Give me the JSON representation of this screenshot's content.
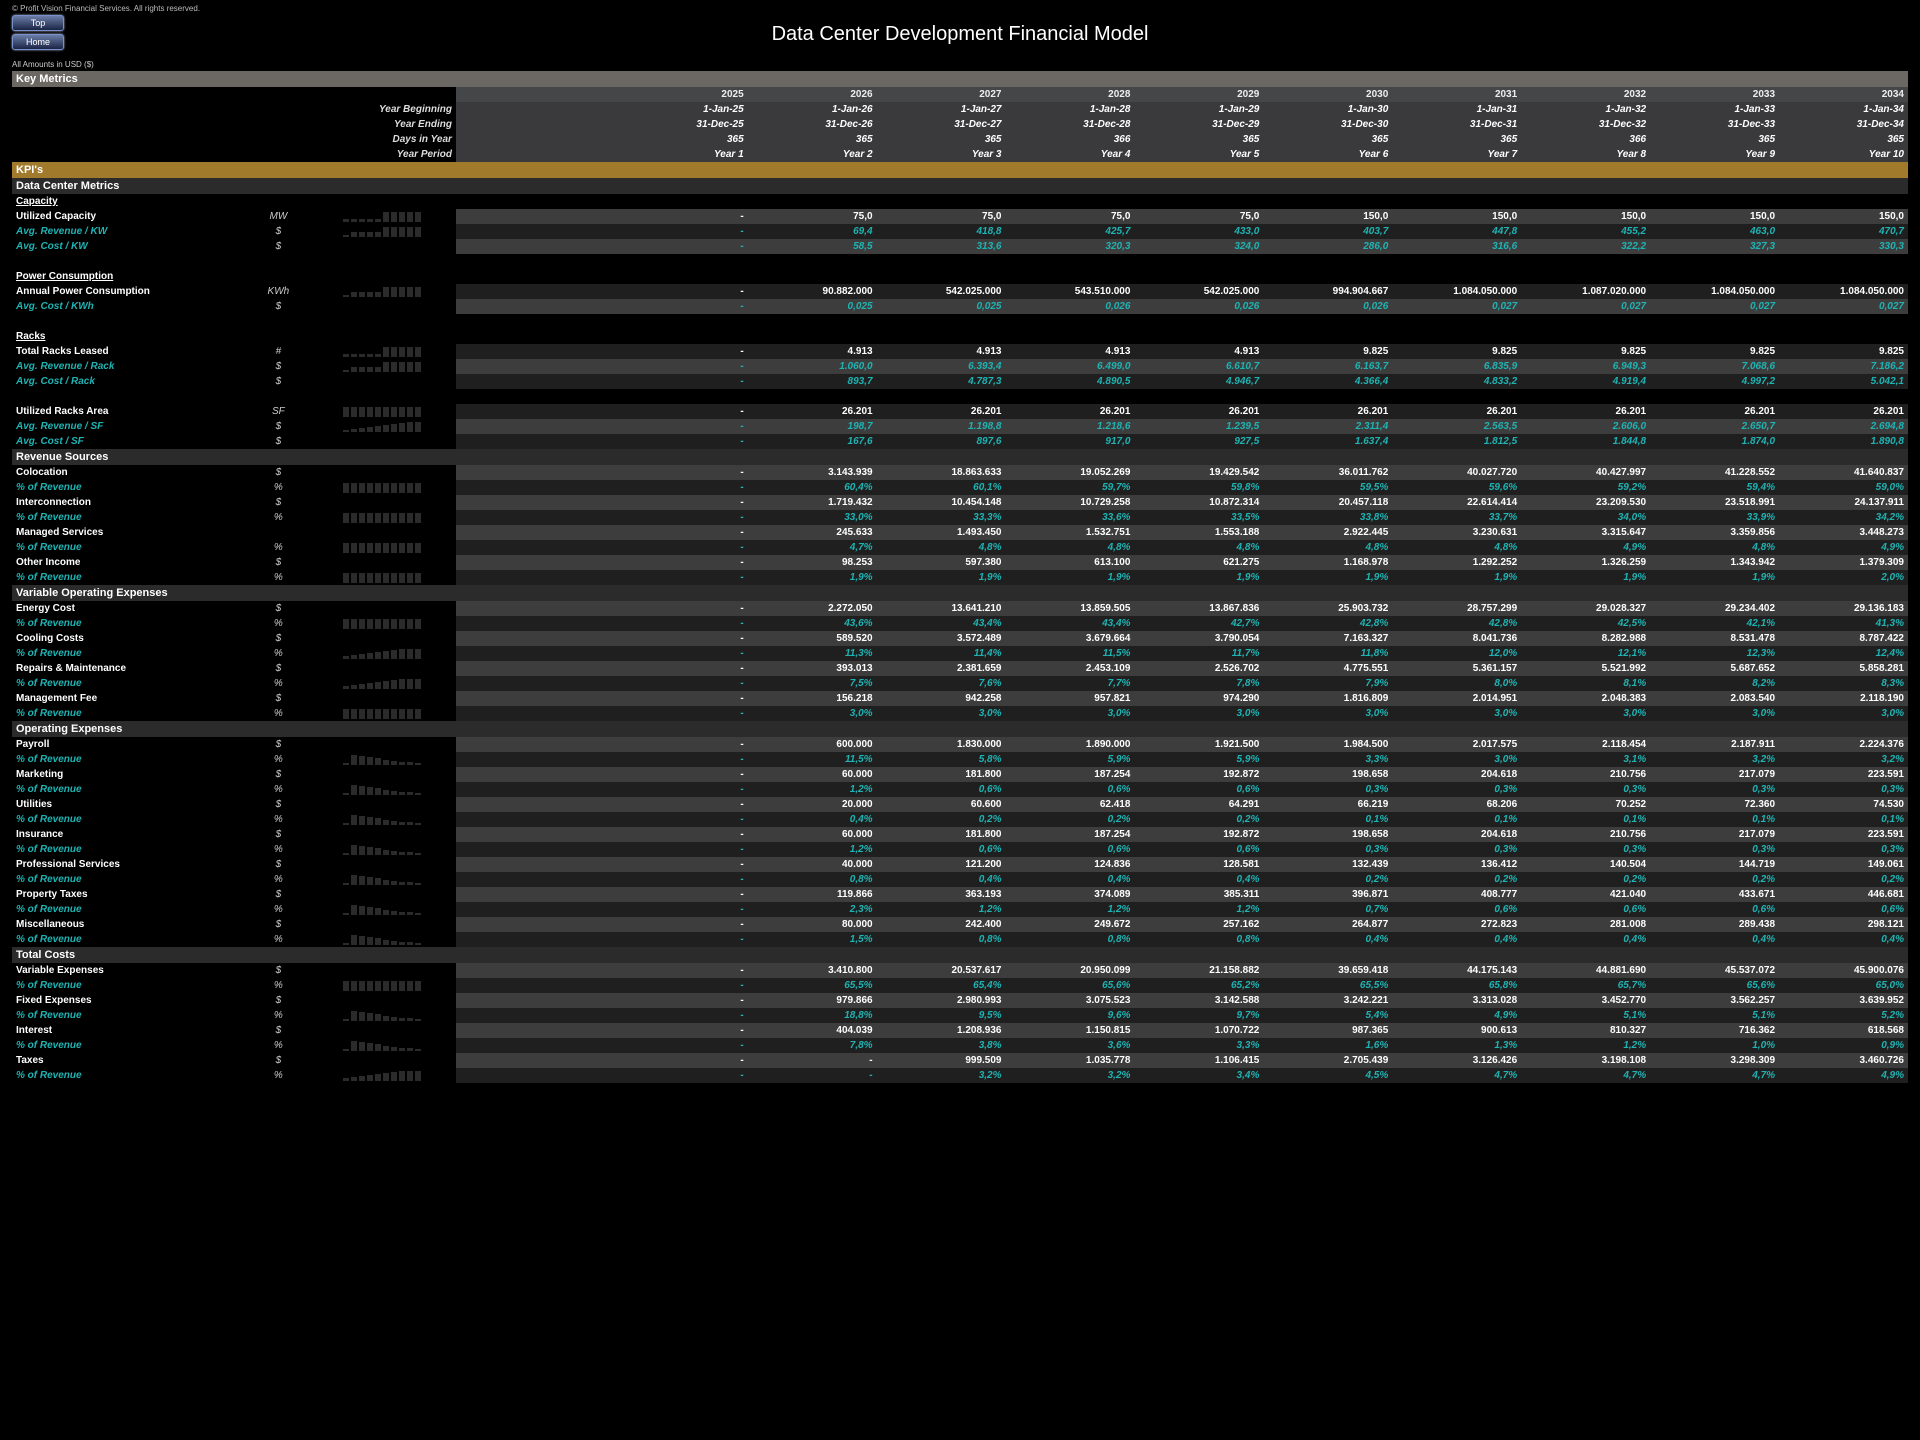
{
  "copyright": "© Profit Vision Financial Services. All rights reserved.",
  "nav": {
    "top": "Top",
    "home": "Home"
  },
  "title": "Data Center Development Financial Model",
  "currency_note": "All Amounts in  USD ($)",
  "bands": {
    "key_metrics": "Key Metrics",
    "kpis": "KPI's",
    "dcm": "Data Center Metrics",
    "rev": "Revenue Sources",
    "vopex": "Variable Operating Expenses",
    "opex": "Operating Expenses",
    "tcosts": "Total Costs"
  },
  "header": {
    "years": [
      "2025",
      "2026",
      "2027",
      "2028",
      "2029",
      "2030",
      "2031",
      "2032",
      "2033",
      "2034"
    ],
    "labels": {
      "yb": "Year Beginning",
      "ye": "Year Ending",
      "dy": "Days in Year",
      "yp": "Year Period"
    },
    "yb": [
      "1-Jan-25",
      "1-Jan-26",
      "1-Jan-27",
      "1-Jan-28",
      "1-Jan-29",
      "1-Jan-30",
      "1-Jan-31",
      "1-Jan-32",
      "1-Jan-33",
      "1-Jan-34"
    ],
    "ye": [
      "31-Dec-25",
      "31-Dec-26",
      "31-Dec-27",
      "31-Dec-28",
      "31-Dec-29",
      "31-Dec-30",
      "31-Dec-31",
      "31-Dec-32",
      "31-Dec-33",
      "31-Dec-34"
    ],
    "dy": [
      "365",
      "365",
      "365",
      "366",
      "365",
      "365",
      "365",
      "366",
      "365",
      "365"
    ],
    "yp": [
      "Year 1",
      "Year 2",
      "Year 3",
      "Year 4",
      "Year 5",
      "Year 6",
      "Year 7",
      "Year 8",
      "Year 9",
      "Year 10"
    ]
  },
  "dcm": {
    "capacity": {
      "title": "Capacity",
      "util_cap": {
        "label": "Utilized Capacity",
        "unit": "MW",
        "vals": [
          "-",
          "75,0",
          "75,0",
          "75,0",
          "75,0",
          "150,0",
          "150,0",
          "150,0",
          "150,0",
          "150,0"
        ]
      },
      "avg_rev_kw": {
        "label": "Avg. Revenue / KW",
        "unit": "$",
        "vals": [
          "-",
          "69,4",
          "418,8",
          "425,7",
          "433,0",
          "403,7",
          "447,8",
          "455,2",
          "463,0",
          "470,7"
        ]
      },
      "avg_cost_kw": {
        "label": "Avg. Cost / KW",
        "unit": "$",
        "vals": [
          "-",
          "58,5",
          "313,6",
          "320,3",
          "324,0",
          "286,0",
          "316,6",
          "322,2",
          "327,3",
          "330,3"
        ]
      }
    },
    "power": {
      "title": "Power Consumption",
      "annual": {
        "label": "Annual Power Consumption",
        "unit": "KWh",
        "vals": [
          "-",
          "90.882.000",
          "542.025.000",
          "543.510.000",
          "542.025.000",
          "994.904.667",
          "1.084.050.000",
          "1.087.020.000",
          "1.084.050.000",
          "1.084.050.000"
        ]
      },
      "avg_cost_kwh": {
        "label": "Avg. Cost / KWh",
        "unit": "$",
        "vals": [
          "-",
          "0,025",
          "0,025",
          "0,026",
          "0,026",
          "0,026",
          "0,027",
          "0,027",
          "0,027",
          "0,027"
        ]
      }
    },
    "racks": {
      "title": "Racks",
      "leased": {
        "label": "Total Racks Leased",
        "unit": "#",
        "vals": [
          "-",
          "4.913",
          "4.913",
          "4.913",
          "4.913",
          "9.825",
          "9.825",
          "9.825",
          "9.825",
          "9.825"
        ]
      },
      "rev_rack": {
        "label": "Avg. Revenue / Rack",
        "unit": "$",
        "vals": [
          "-",
          "1.060,0",
          "6.393,4",
          "6.499,0",
          "6.610,7",
          "6.163,7",
          "6.835,9",
          "6.949,3",
          "7.068,6",
          "7.186,2"
        ]
      },
      "cost_rack": {
        "label": "Avg. Cost / Rack",
        "unit": "$",
        "vals": [
          "-",
          "893,7",
          "4.787,3",
          "4.890,5",
          "4.946,7",
          "4.366,4",
          "4.833,2",
          "4.919,4",
          "4.997,2",
          "5.042,1"
        ]
      },
      "area": {
        "label": "Utilized Racks Area",
        "unit": "SF",
        "vals": [
          "-",
          "26.201",
          "26.201",
          "26.201",
          "26.201",
          "26.201",
          "26.201",
          "26.201",
          "26.201",
          "26.201"
        ]
      },
      "rev_sf": {
        "label": "Avg. Revenue / SF",
        "unit": "$",
        "vals": [
          "-",
          "198,7",
          "1.198,8",
          "1.218,6",
          "1.239,5",
          "2.311,4",
          "2.563,5",
          "2.606,0",
          "2.650,7",
          "2.694,8"
        ]
      },
      "cost_sf": {
        "label": "Avg. Cost / SF",
        "unit": "$",
        "vals": [
          "-",
          "167,6",
          "897,6",
          "917,0",
          "927,5",
          "1.637,4",
          "1.812,5",
          "1.844,8",
          "1.874,0",
          "1.890,8"
        ]
      }
    }
  },
  "rev": {
    "colo": {
      "label": "Colocation",
      "unit": "$",
      "vals": [
        "-",
        "3.143.939",
        "18.863.633",
        "19.052.269",
        "19.429.542",
        "36.011.762",
        "40.027.720",
        "40.427.997",
        "41.228.552",
        "41.640.837"
      ],
      "pct": [
        "-",
        "60,4%",
        "60,1%",
        "59,7%",
        "59,8%",
        "59,5%",
        "59,6%",
        "59,2%",
        "59,4%",
        "59,0%"
      ]
    },
    "inter": {
      "label": "Interconnection",
      "unit": "$",
      "vals": [
        "-",
        "1.719.432",
        "10.454.148",
        "10.729.258",
        "10.872.314",
        "20.457.118",
        "22.614.414",
        "23.209.530",
        "23.518.991",
        "24.137.911"
      ],
      "pct": [
        "-",
        "33,0%",
        "33,3%",
        "33,6%",
        "33,5%",
        "33,8%",
        "33,7%",
        "34,0%",
        "33,9%",
        "34,2%"
      ]
    },
    "mgd": {
      "label": "Managed Services",
      "unit": "",
      "vals": [
        "-",
        "245.633",
        "1.493.450",
        "1.532.751",
        "1.553.188",
        "2.922.445",
        "3.230.631",
        "3.315.647",
        "3.359.856",
        "3.448.273"
      ],
      "pct": [
        "-",
        "4,7%",
        "4,8%",
        "4,8%",
        "4,8%",
        "4,8%",
        "4,8%",
        "4,9%",
        "4,8%",
        "4,9%"
      ]
    },
    "other": {
      "label": "Other Income",
      "unit": "$",
      "vals": [
        "-",
        "98.253",
        "597.380",
        "613.100",
        "621.275",
        "1.168.978",
        "1.292.252",
        "1.326.259",
        "1.343.942",
        "1.379.309"
      ],
      "pct": [
        "-",
        "1,9%",
        "1,9%",
        "1,9%",
        "1,9%",
        "1,9%",
        "1,9%",
        "1,9%",
        "1,9%",
        "2,0%"
      ]
    },
    "pct_label": "% of Revenue"
  },
  "vopex": {
    "pct_label": "% of Revenue",
    "energy": {
      "label": "Energy Cost",
      "unit": "$",
      "vals": [
        "-",
        "2.272.050",
        "13.641.210",
        "13.859.505",
        "13.867.836",
        "25.903.732",
        "28.757.299",
        "29.028.327",
        "29.234.402",
        "29.136.183"
      ],
      "pct": [
        "-",
        "43,6%",
        "43,4%",
        "43,4%",
        "42,7%",
        "42,8%",
        "42,8%",
        "42,5%",
        "42,1%",
        "41,3%"
      ]
    },
    "cooling": {
      "label": "Cooling Costs",
      "unit": "$",
      "vals": [
        "-",
        "589.520",
        "3.572.489",
        "3.679.664",
        "3.790.054",
        "7.163.327",
        "8.041.736",
        "8.282.988",
        "8.531.478",
        "8.787.422"
      ],
      "pct": [
        "-",
        "11,3%",
        "11,4%",
        "11,5%",
        "11,7%",
        "11,8%",
        "12,0%",
        "12,1%",
        "12,3%",
        "12,4%"
      ]
    },
    "repairs": {
      "label": "Repairs & Maintenance",
      "unit": "$",
      "vals": [
        "-",
        "393.013",
        "2.381.659",
        "2.453.109",
        "2.526.702",
        "4.775.551",
        "5.361.157",
        "5.521.992",
        "5.687.652",
        "5.858.281"
      ],
      "pct": [
        "-",
        "7,5%",
        "7,6%",
        "7,7%",
        "7,8%",
        "7,9%",
        "8,0%",
        "8,1%",
        "8,2%",
        "8,3%"
      ]
    },
    "mgmt": {
      "label": "Management Fee",
      "unit": "$",
      "vals": [
        "-",
        "156.218",
        "942.258",
        "957.821",
        "974.290",
        "1.816.809",
        "2.014.951",
        "2.048.383",
        "2.083.540",
        "2.118.190"
      ],
      "pct": [
        "-",
        "3,0%",
        "3,0%",
        "3,0%",
        "3,0%",
        "3,0%",
        "3,0%",
        "3,0%",
        "3,0%",
        "3,0%"
      ]
    }
  },
  "opex": {
    "pct_label": "% of Revenue",
    "payroll": {
      "label": "Payroll",
      "unit": "$",
      "vals": [
        "-",
        "600.000",
        "1.830.000",
        "1.890.000",
        "1.921.500",
        "1.984.500",
        "2.017.575",
        "2.118.454",
        "2.187.911",
        "2.224.376"
      ],
      "pct": [
        "-",
        "11,5%",
        "5,8%",
        "5,9%",
        "5,9%",
        "3,3%",
        "3,0%",
        "3,1%",
        "3,2%",
        "3,2%"
      ]
    },
    "marketing": {
      "label": "Marketing",
      "unit": "$",
      "vals": [
        "-",
        "60.000",
        "181.800",
        "187.254",
        "192.872",
        "198.658",
        "204.618",
        "210.756",
        "217.079",
        "223.591"
      ],
      "pct": [
        "-",
        "1,2%",
        "0,6%",
        "0,6%",
        "0,6%",
        "0,3%",
        "0,3%",
        "0,3%",
        "0,3%",
        "0,3%"
      ]
    },
    "utilities": {
      "label": "Utilities",
      "unit": "$",
      "vals": [
        "-",
        "20.000",
        "60.600",
        "62.418",
        "64.291",
        "66.219",
        "68.206",
        "70.252",
        "72.360",
        "74.530"
      ],
      "pct": [
        "-",
        "0,4%",
        "0,2%",
        "0,2%",
        "0,2%",
        "0,1%",
        "0,1%",
        "0,1%",
        "0,1%",
        "0,1%"
      ]
    },
    "insurance": {
      "label": "Insurance",
      "unit": "$",
      "vals": [
        "-",
        "60.000",
        "181.800",
        "187.254",
        "192.872",
        "198.658",
        "204.618",
        "210.756",
        "217.079",
        "223.591"
      ],
      "pct": [
        "-",
        "1,2%",
        "0,6%",
        "0,6%",
        "0,6%",
        "0,3%",
        "0,3%",
        "0,3%",
        "0,3%",
        "0,3%"
      ]
    },
    "prof": {
      "label": "Professional Services",
      "unit": "$",
      "vals": [
        "-",
        "40.000",
        "121.200",
        "124.836",
        "128.581",
        "132.439",
        "136.412",
        "140.504",
        "144.719",
        "149.061"
      ],
      "pct": [
        "-",
        "0,8%",
        "0,4%",
        "0,4%",
        "0,4%",
        "0,2%",
        "0,2%",
        "0,2%",
        "0,2%",
        "0,2%"
      ]
    },
    "proptax": {
      "label": "Property Taxes",
      "unit": "$",
      "vals": [
        "-",
        "119.866",
        "363.193",
        "374.089",
        "385.311",
        "396.871",
        "408.777",
        "421.040",
        "433.671",
        "446.681"
      ],
      "pct": [
        "-",
        "2,3%",
        "1,2%",
        "1,2%",
        "1,2%",
        "0,7%",
        "0,6%",
        "0,6%",
        "0,6%",
        "0,6%"
      ]
    },
    "misc": {
      "label": "Miscellaneous",
      "unit": "$",
      "vals": [
        "-",
        "80.000",
        "242.400",
        "249.672",
        "257.162",
        "264.877",
        "272.823",
        "281.008",
        "289.438",
        "298.121"
      ],
      "pct": [
        "-",
        "1,5%",
        "0,8%",
        "0,8%",
        "0,8%",
        "0,4%",
        "0,4%",
        "0,4%",
        "0,4%",
        "0,4%"
      ]
    }
  },
  "tcosts": {
    "pct_label": "% of Revenue",
    "varexp": {
      "label": "Variable Expenses",
      "unit": "$",
      "vals": [
        "-",
        "3.410.800",
        "20.537.617",
        "20.950.099",
        "21.158.882",
        "39.659.418",
        "44.175.143",
        "44.881.690",
        "45.537.072",
        "45.900.076"
      ],
      "pct": [
        "-",
        "65,5%",
        "65,4%",
        "65,6%",
        "65,2%",
        "65,5%",
        "65,8%",
        "65,7%",
        "65,6%",
        "65,0%"
      ]
    },
    "fixedexp": {
      "label": "Fixed Expenses",
      "unit": "$",
      "vals": [
        "-",
        "979.866",
        "2.980.993",
        "3.075.523",
        "3.142.588",
        "3.242.221",
        "3.313.028",
        "3.452.770",
        "3.562.257",
        "3.639.952"
      ],
      "pct": [
        "-",
        "18,8%",
        "9,5%",
        "9,6%",
        "9,7%",
        "5,4%",
        "4,9%",
        "5,1%",
        "5,1%",
        "5,2%"
      ]
    },
    "interest": {
      "label": "Interest",
      "unit": "$",
      "vals": [
        "-",
        "404.039",
        "1.208.936",
        "1.150.815",
        "1.070.722",
        "987.365",
        "900.613",
        "810.327",
        "716.362",
        "618.568"
      ],
      "pct": [
        "-",
        "7,8%",
        "3,8%",
        "3,6%",
        "3,3%",
        "1,6%",
        "1,3%",
        "1,2%",
        "1,0%",
        "0,9%"
      ]
    },
    "taxes": {
      "label": "Taxes",
      "unit": "$",
      "vals": [
        "-",
        "-",
        "999.509",
        "1.035.778",
        "1.106.415",
        "2.705.439",
        "3.126.426",
        "3.198.108",
        "3.298.309",
        "3.460.726"
      ],
      "pct": [
        "-",
        "-",
        "3,2%",
        "3,2%",
        "3,4%",
        "4,5%",
        "4,7%",
        "4,7%",
        "4,7%",
        "4,9%"
      ]
    }
  },
  "sparks": {
    "step": [
      2,
      2,
      2,
      2,
      2,
      9,
      9,
      9,
      9,
      9
    ],
    "low_step": [
      1,
      4,
      4,
      4,
      4,
      9,
      9,
      9,
      9,
      9
    ],
    "ramp": [
      1,
      2,
      3,
      4,
      5,
      6,
      7,
      8,
      9,
      9
    ],
    "full": [
      9,
      9,
      9,
      9,
      9,
      9,
      9,
      9,
      9,
      9
    ],
    "ramp2": [
      2,
      3,
      4,
      5,
      6,
      7,
      8,
      9,
      9,
      9
    ],
    "dec": [
      1,
      9,
      8,
      7,
      6,
      4,
      3,
      2,
      2,
      1
    ]
  }
}
